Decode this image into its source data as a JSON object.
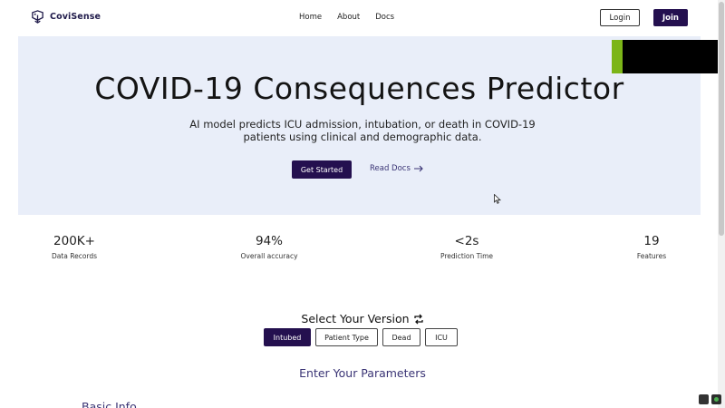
{
  "nav": {
    "brand": "CoviSense",
    "links": [
      "Home",
      "About",
      "Docs"
    ],
    "login_label": "Login",
    "join_label": "Join"
  },
  "hero": {
    "title": "COVID-19 Consequences Predictor",
    "subtitle": "AI model predicts ICU admission, intubation, or death in COVID-19 patients using clinical and demographic data.",
    "primary_button": "Get Started",
    "secondary_link": "Read Docs",
    "secondary_icon": "arrow-right-icon"
  },
  "stats": [
    {
      "value": "200K+",
      "label": "Data Records"
    },
    {
      "value": "94%",
      "label": "Overall accuracy"
    },
    {
      "value": "<2s",
      "label": "Prediction Time"
    },
    {
      "value": "19",
      "label": "Features"
    }
  ],
  "version": {
    "title": "Select Your Version",
    "icon": "swap-icon",
    "options": [
      "Intubed",
      "Patient Type",
      "Dead",
      "ICU"
    ],
    "selected": "Intubed"
  },
  "params": {
    "title": "Enter Your Parameters",
    "section": "Basic Info"
  },
  "colors": {
    "primary": "#24104f",
    "hero_bg": "#e9eef9",
    "accent_green": "#7cb518",
    "link": "#3a3475"
  }
}
